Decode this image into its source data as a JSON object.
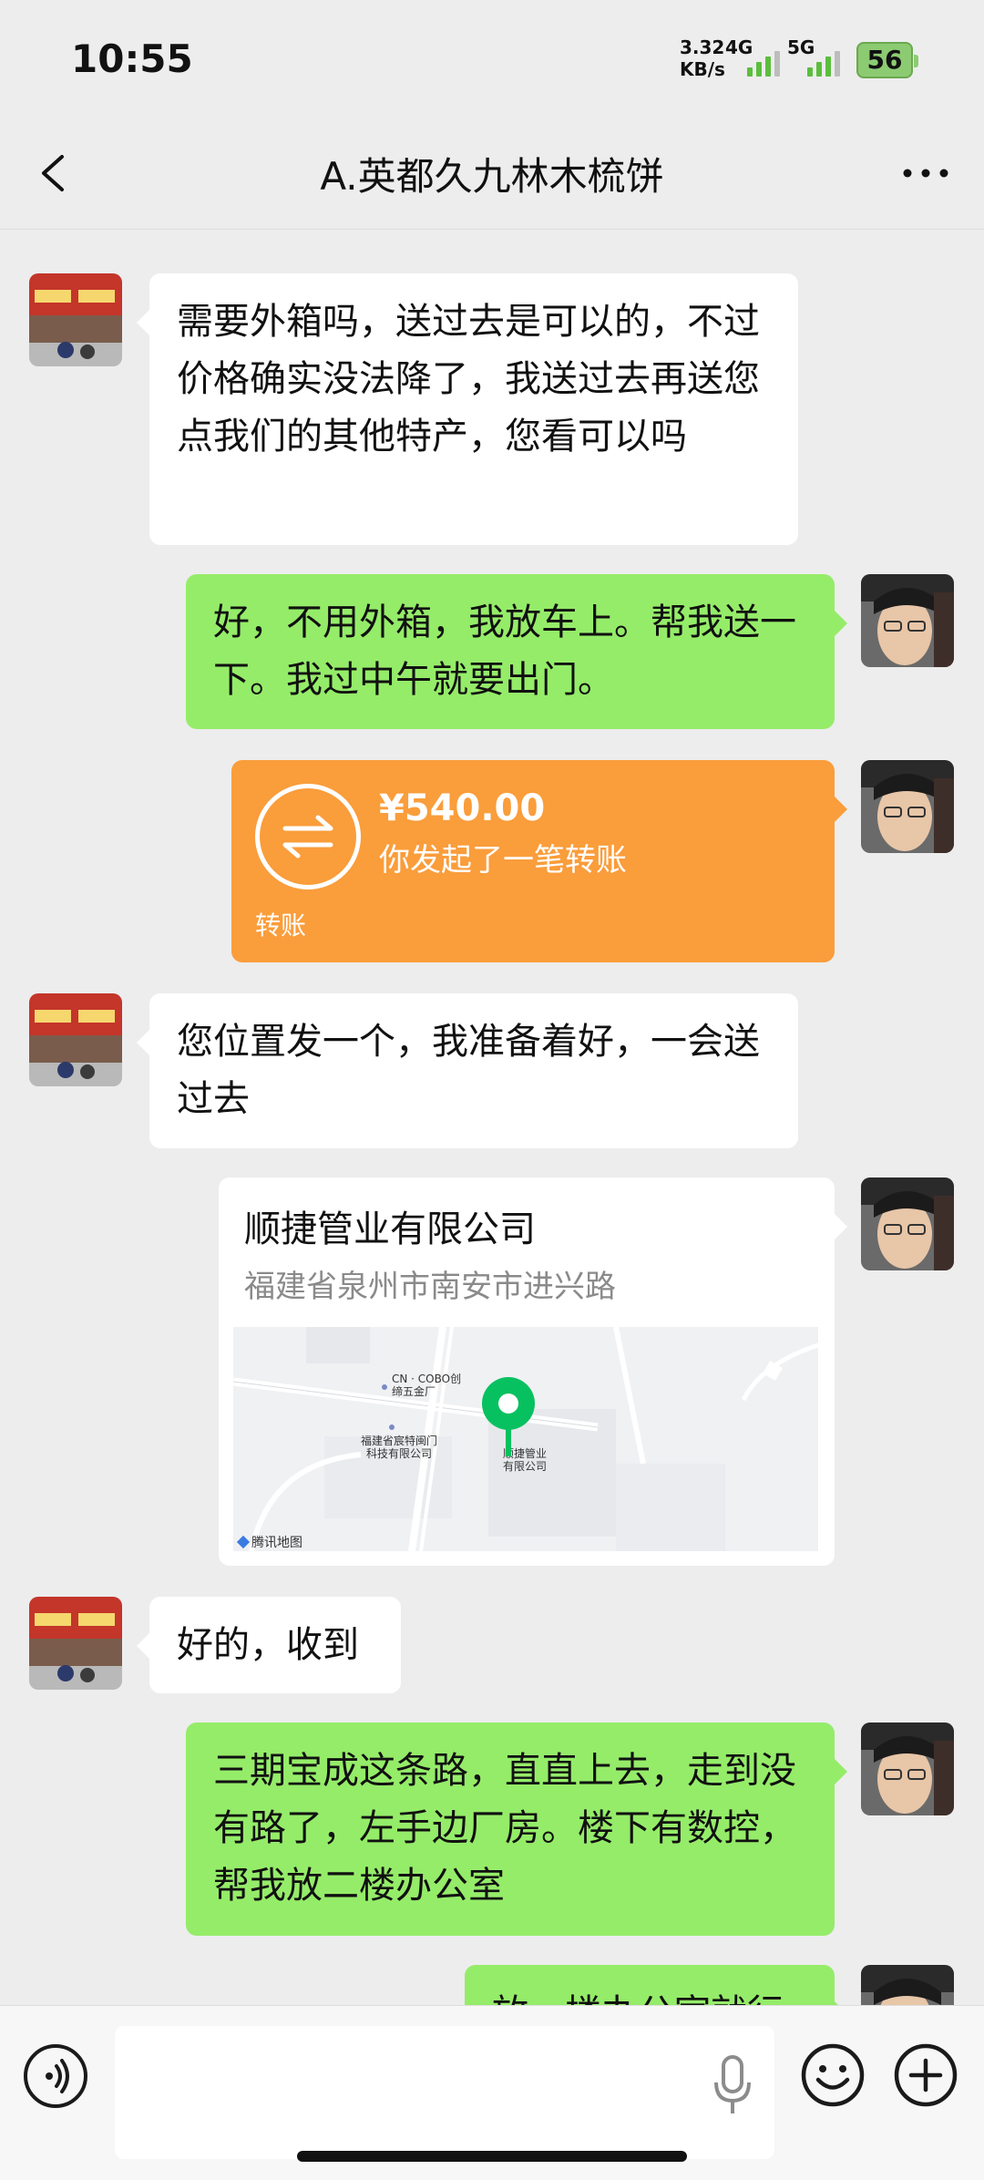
{
  "status": {
    "time": "10:55",
    "speed_value": "3.32",
    "speed_unit": "KB/s",
    "net1": "4G",
    "net2": "5G",
    "battery": "56"
  },
  "header": {
    "title": "A.英都久九林木梳饼",
    "back_icon": "chevron-left-icon",
    "more_icon": "more-dots-icon"
  },
  "messages": [
    {
      "from": "them",
      "text": "需要外箱吗，送过去是可以的，不过价格确实没法降了，我送过去再送您点我们的其他特产，您看可以吗"
    },
    {
      "from": "me",
      "text": "好，不用外箱，我放车上。帮我送一下。我过中午就要出门。"
    },
    {
      "from": "me",
      "type": "transfer",
      "amount": "¥540.00",
      "desc": "你发起了一笔转账",
      "label": "转账"
    },
    {
      "from": "them",
      "text": "您位置发一个，我准备着好，一会送过去"
    },
    {
      "from": "me",
      "type": "location",
      "name": "顺捷管业有限公司",
      "address": "福建省泉州市南安市进兴路",
      "map_labels": [
        "CN · COBO创",
        "缔五金厂",
        "福建省宸特闽门",
        "科技有限公司",
        "顺捷管业",
        "有限公司",
        "腾讯地图"
      ]
    },
    {
      "from": "them",
      "text": "好的，收到"
    },
    {
      "from": "me",
      "text": "三期宝成这条路，直直上去，走到没有路了，左手边厂房。楼下有数控，帮我放二楼办公室"
    },
    {
      "from": "me",
      "text": "放一楼办公室就行"
    }
  ],
  "colors": {
    "outgoing": "#95EC69",
    "incoming": "#FFFFFF",
    "transfer": "#FA9D3B",
    "background": "#EDEDED",
    "pin": "#07C160"
  }
}
